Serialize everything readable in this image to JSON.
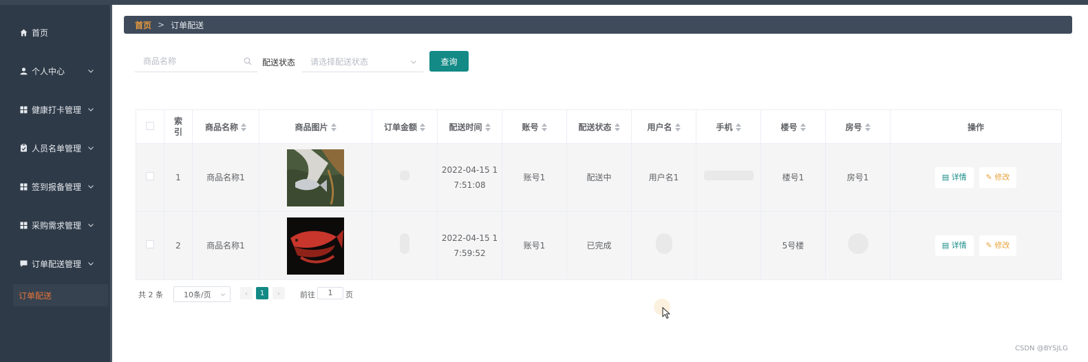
{
  "sidebar": {
    "items": [
      {
        "label": "首页",
        "icon": "home-icon",
        "has_children": false
      },
      {
        "label": "个人中心",
        "icon": "user-icon",
        "has_children": true
      },
      {
        "label": "健康打卡管理",
        "icon": "grid-icon",
        "has_children": true
      },
      {
        "label": "人员名单管理",
        "icon": "clipboard-icon",
        "has_children": true
      },
      {
        "label": "签到报备管理",
        "icon": "grid-icon",
        "has_children": true
      },
      {
        "label": "采购需求管理",
        "icon": "grid-icon",
        "has_children": true
      },
      {
        "label": "订单配送管理",
        "icon": "chat-icon",
        "has_children": true
      }
    ],
    "active_subitem": "订单配送"
  },
  "breadcrumb": {
    "home": "首页",
    "separator": ">",
    "current": "订单配送"
  },
  "filters": {
    "product_name_placeholder": "商品名称",
    "status_label": "配送状态",
    "status_placeholder": "请选择配送状态",
    "query_button": "查询"
  },
  "table": {
    "headers": {
      "index": "索\n引",
      "product_name": "商品名称",
      "product_image": "商品图片",
      "order_amount": "订单金额",
      "delivery_time": "配送时间",
      "account": "账号",
      "delivery_status": "配送状态",
      "username": "用户名",
      "phone": "手机",
      "building": "楼号",
      "room": "房号",
      "actions": "操作"
    },
    "rows": [
      {
        "index": "1",
        "product_name": "商品名称1",
        "image": "fish-in-hand-photo",
        "amount": "",
        "time_line1": "2022-04-15 1",
        "time_line2": "7:51:08",
        "account": "账号1",
        "status": "配送中",
        "username": "用户名1",
        "phone": "",
        "building": "楼号1",
        "room": "房号1"
      },
      {
        "index": "2",
        "product_name": "商品名称1",
        "image": "red-arowana-photo",
        "amount": "",
        "time_line1": "2022-04-15 1",
        "time_line2": "7:59:52",
        "account": "账号1",
        "status": "已完成",
        "username": "",
        "phone": "",
        "building": "5号楼",
        "room": ""
      }
    ],
    "action_detail": "详情",
    "action_edit": "修改"
  },
  "pagination": {
    "total_prefix": "共",
    "total_count": "2",
    "total_suffix": "条",
    "page_size": "10条/页",
    "current_page": "1",
    "goto_label": "前往",
    "goto_value": "1",
    "goto_suffix": "页"
  },
  "watermark": "CSDN @BYSJLG",
  "colors": {
    "accent": "#138a86",
    "sidebar_bg": "#2e3a48",
    "active_text": "#e8743b",
    "breadcrumb_bg": "#3f4b5b",
    "edit": "#e6a23c"
  }
}
